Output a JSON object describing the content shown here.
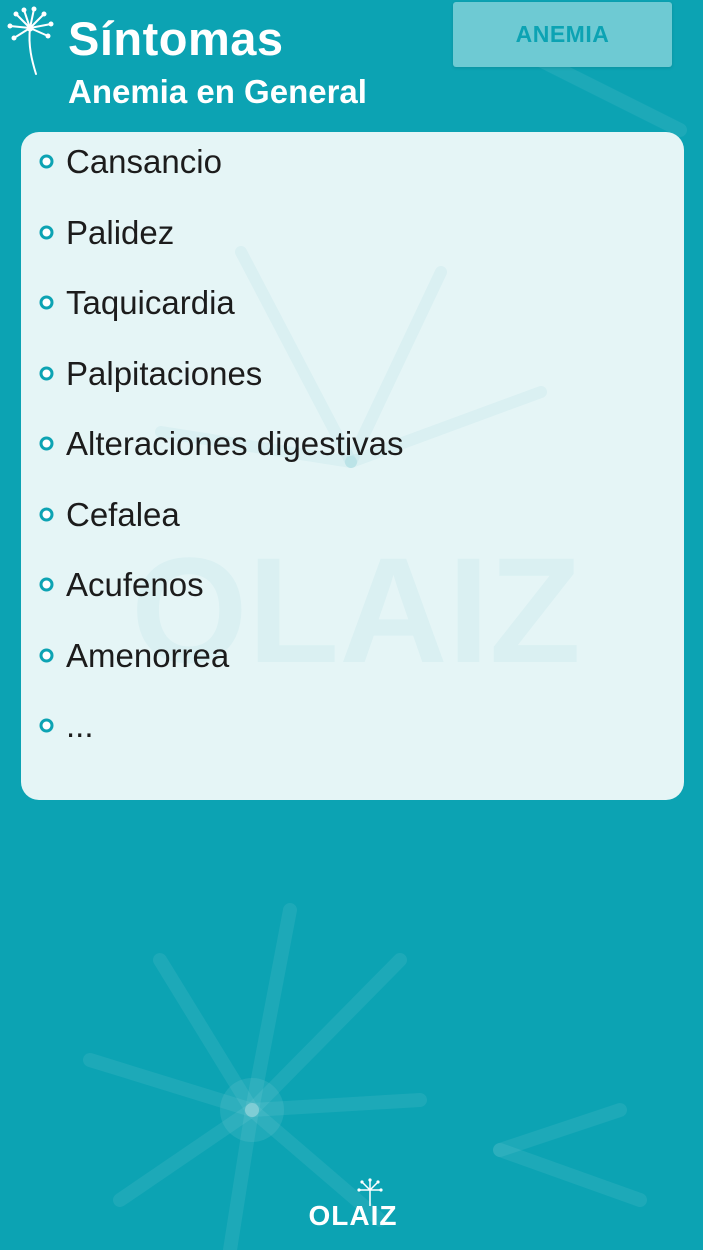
{
  "header": {
    "title": "Síntomas",
    "subtitle": "Anemia en General",
    "tab_label": "ANEMIA"
  },
  "symptoms": [
    "Cansancio",
    "Palidez",
    "Taquicardia",
    "Palpitaciones",
    "Alteraciones digestivas",
    "Cefalea",
    "Acufenos",
    "Amenorrea",
    "..."
  ],
  "footer": {
    "brand": "OLAIZ"
  },
  "colors": {
    "background": "#0ca3b3",
    "tab_bg": "#6ecad3",
    "card_bg": "#ecf8f8",
    "text_dark": "#1c1c1c",
    "bullet": "#0ca3b3"
  },
  "icons": {
    "header_logo": "dandelion-icon",
    "bullet": "bullet-dot-icon",
    "footer_logo": "dandelion-icon"
  }
}
